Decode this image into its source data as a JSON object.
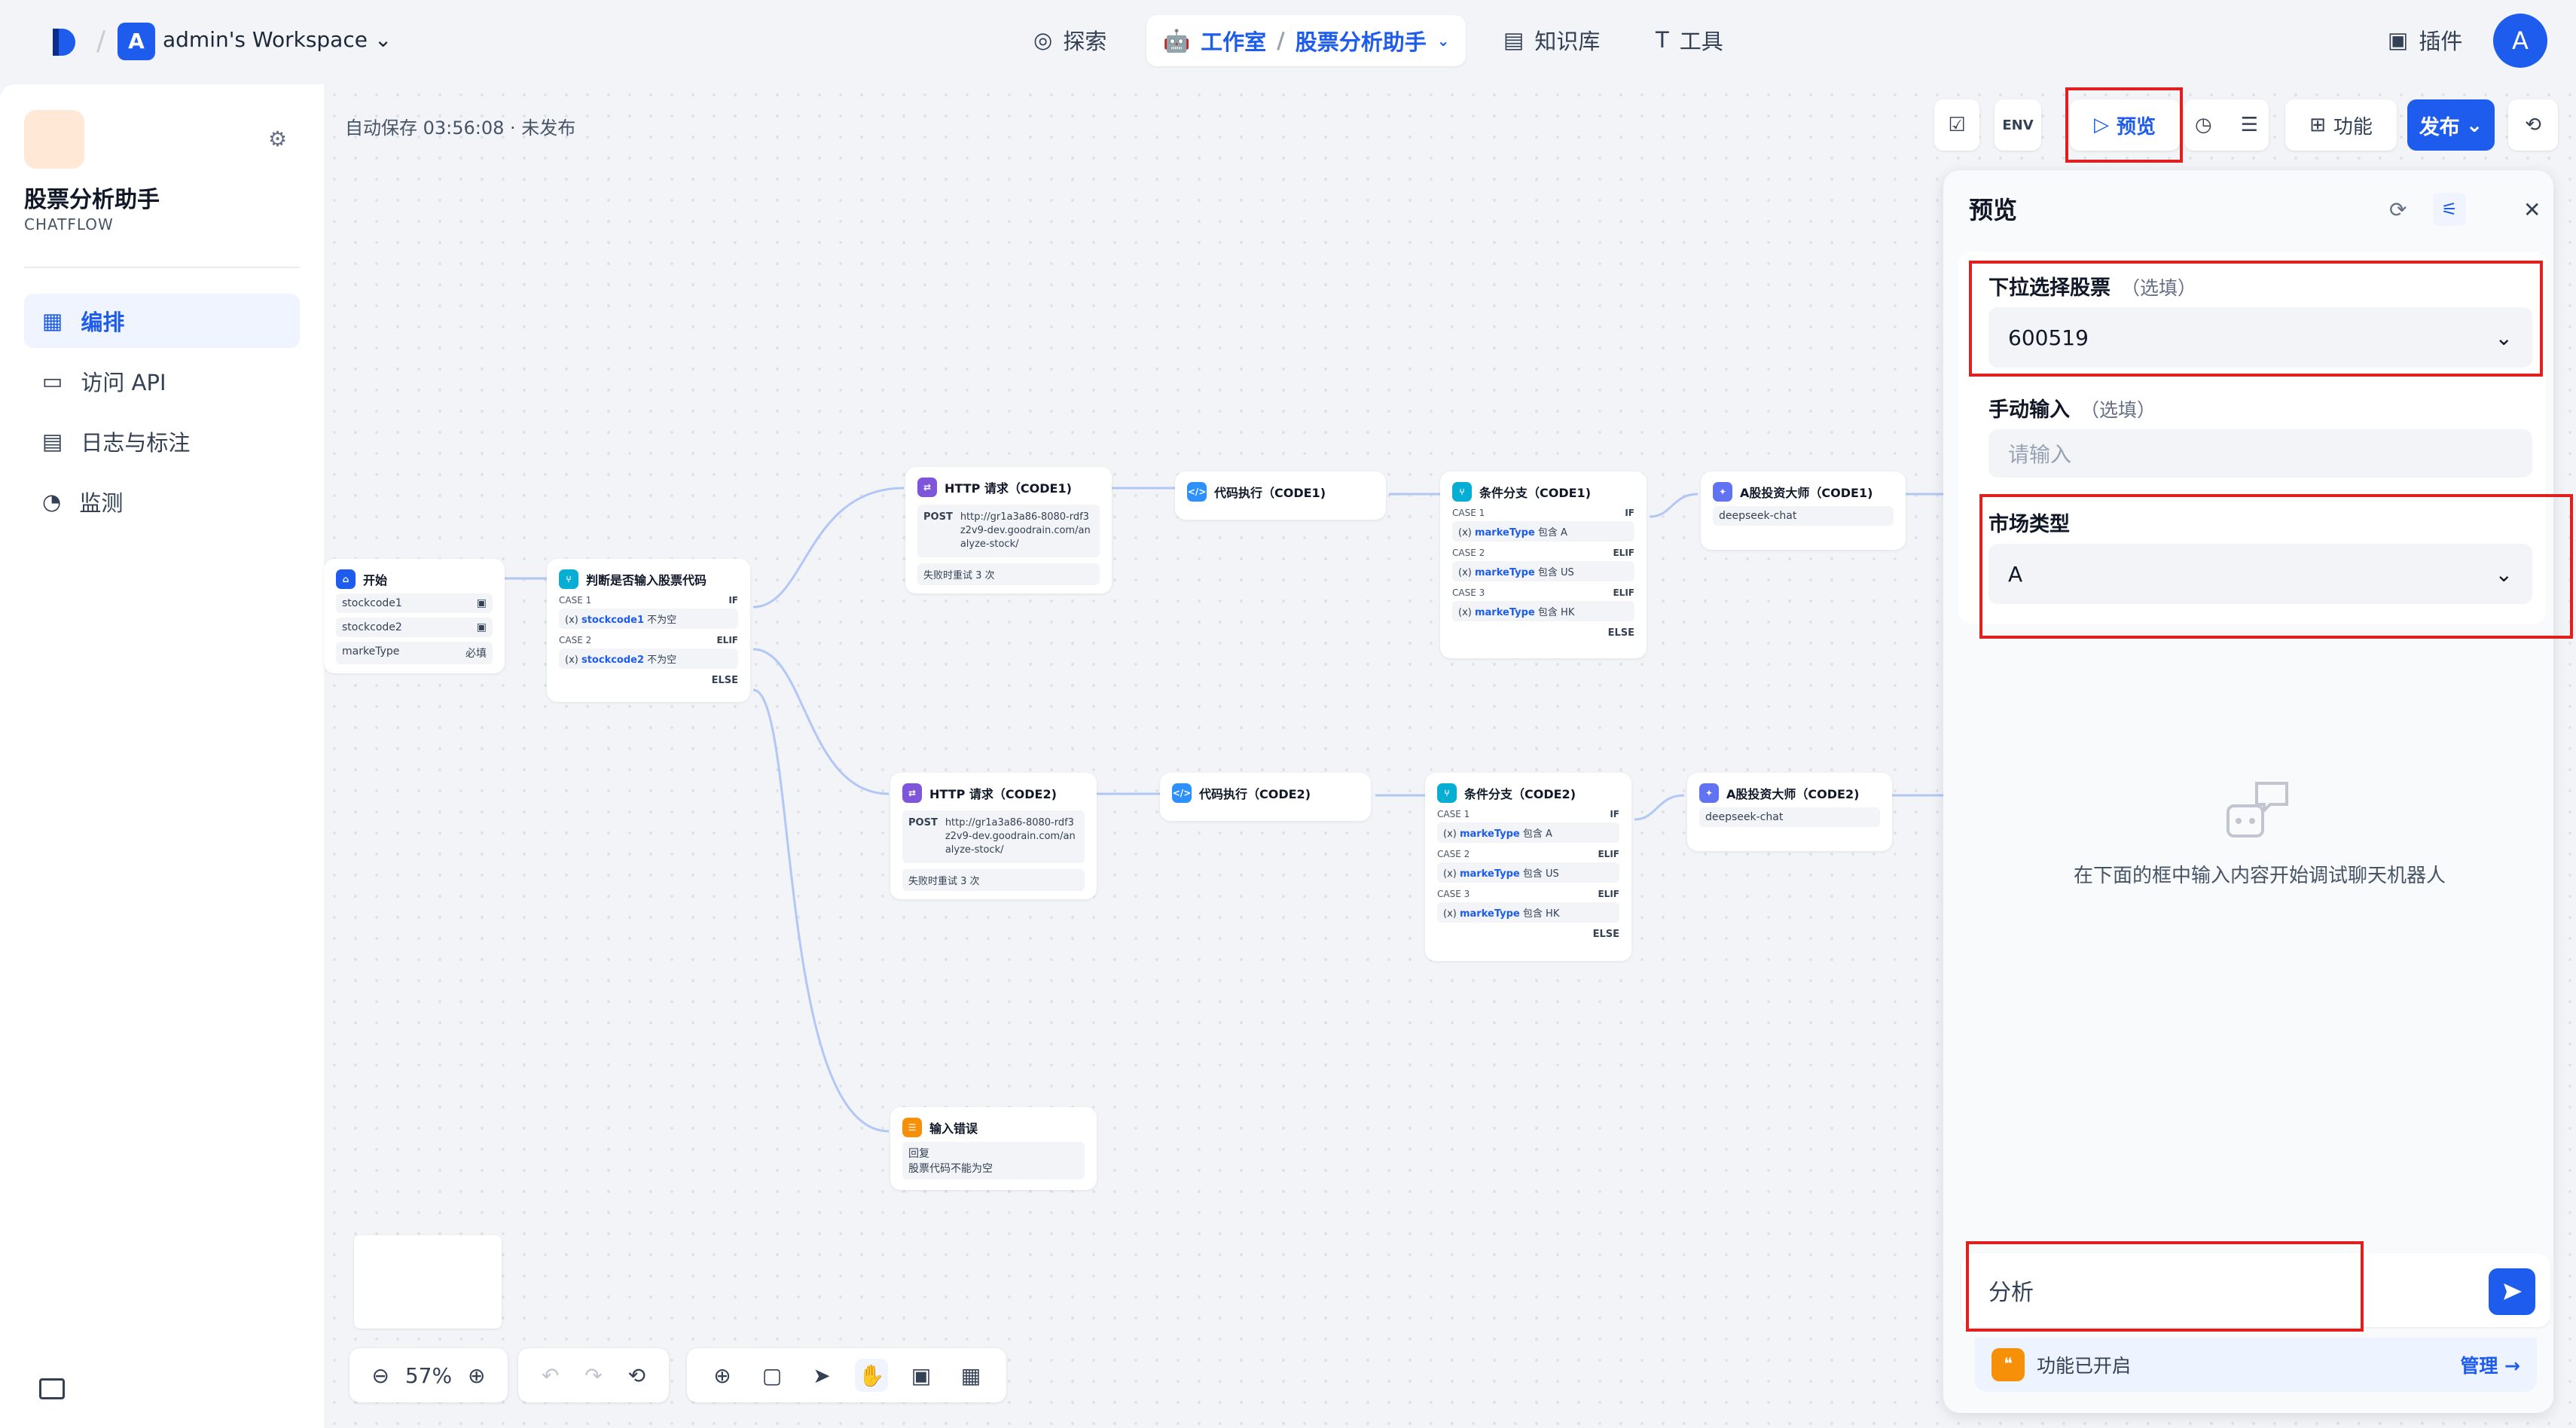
{
  "header": {
    "workspace_initial": "A",
    "workspace_name": "admin's Workspace",
    "nav_explore": "探索",
    "nav_studio": "工作室",
    "nav_app": "股票分析助手",
    "nav_knowledge": "知识库",
    "nav_tools": "工具",
    "plugins": "插件",
    "user_initial": "A"
  },
  "sidebar": {
    "app_name": "股票分析助手",
    "app_type": "CHATFLOW",
    "items": [
      {
        "label": "编排",
        "icon": "layout-icon"
      },
      {
        "label": "访问 API",
        "icon": "terminal-icon"
      },
      {
        "label": "日志与标注",
        "icon": "log-icon"
      },
      {
        "label": "监测",
        "icon": "gauge-icon"
      }
    ]
  },
  "canvas": {
    "autosave": "自动保存 03:56:08 · 未发布",
    "zoom": "57%",
    "nodes": {
      "start": {
        "title": "开始",
        "vars": [
          "stockcode1",
          "stockcode2",
          "markeType"
        ],
        "required": "必填"
      },
      "judge": {
        "title": "判断是否输入股票代码",
        "case1": "CASE 1",
        "if": "IF",
        "cond1_var": "stockcode1",
        "cond1_op": "不为空",
        "case2": "CASE 2",
        "elif": "ELIF",
        "cond2_var": "stockcode2",
        "cond2_op": "不为空",
        "else": "ELSE"
      },
      "http1": {
        "title": "HTTP 请求（CODE1)",
        "method": "POST",
        "url": "http://gr1a3a86-8080-rdf3z2v9-dev.goodrain.com/analyze-stock/",
        "retry": "失败时重试 3 次"
      },
      "code1": {
        "title": "代码执行（CODE1)"
      },
      "branch1": {
        "title": "条件分支（CODE1)",
        "case1": "CASE 1",
        "case2": "CASE 2",
        "case3": "CASE 3",
        "if": "IF",
        "elif": "ELIF",
        "else": "ELSE",
        "var": "markeType",
        "op": "包含",
        "v1": "A",
        "v2": "US",
        "v3": "HK"
      },
      "llm1": {
        "title": "A股投资大师（CODE1)",
        "model": "deepseek-chat"
      },
      "http2": {
        "title": "HTTP 请求（CODE2)",
        "method": "POST",
        "url": "http://gr1a3a86-8080-rdf3z2v9-dev.goodrain.com/analyze-stock/",
        "retry": "失败时重试 3 次"
      },
      "code2": {
        "title": "代码执行（CODE2)"
      },
      "branch2": {
        "title": "条件分支（CODE2)",
        "case1": "CASE 1",
        "case2": "CASE 2",
        "case3": "CASE 3",
        "if": "IF",
        "elif": "ELIF",
        "else": "ELSE",
        "var": "markeType",
        "op": "包含",
        "v1": "A",
        "v2": "US",
        "v3": "HK"
      },
      "llm2": {
        "title": "A股投资大师（CODE2)",
        "model": "deepseek-chat"
      },
      "err": {
        "title": "输入错误",
        "label": "回复",
        "text": "股票代码不能为空"
      }
    }
  },
  "toolbar": {
    "env": "ENV",
    "preview": "预览",
    "features": "功能",
    "publish": "发布"
  },
  "preview": {
    "title": "预览",
    "field1_label": "下拉选择股票",
    "field1_optional": "（选填）",
    "field1_value": "600519",
    "field2_label": "手动输入",
    "field2_optional": "（选填）",
    "field2_placeholder": "请输入",
    "field3_label": "市场类型",
    "field3_value": "A",
    "empty_text": "在下面的框中输入内容开始调试聊天机器人",
    "chat_value": "分析",
    "feature_status": "功能已开启",
    "manage": "管理"
  },
  "colors": {
    "accent": "#1d5ced",
    "highlight": "#e0201f"
  }
}
